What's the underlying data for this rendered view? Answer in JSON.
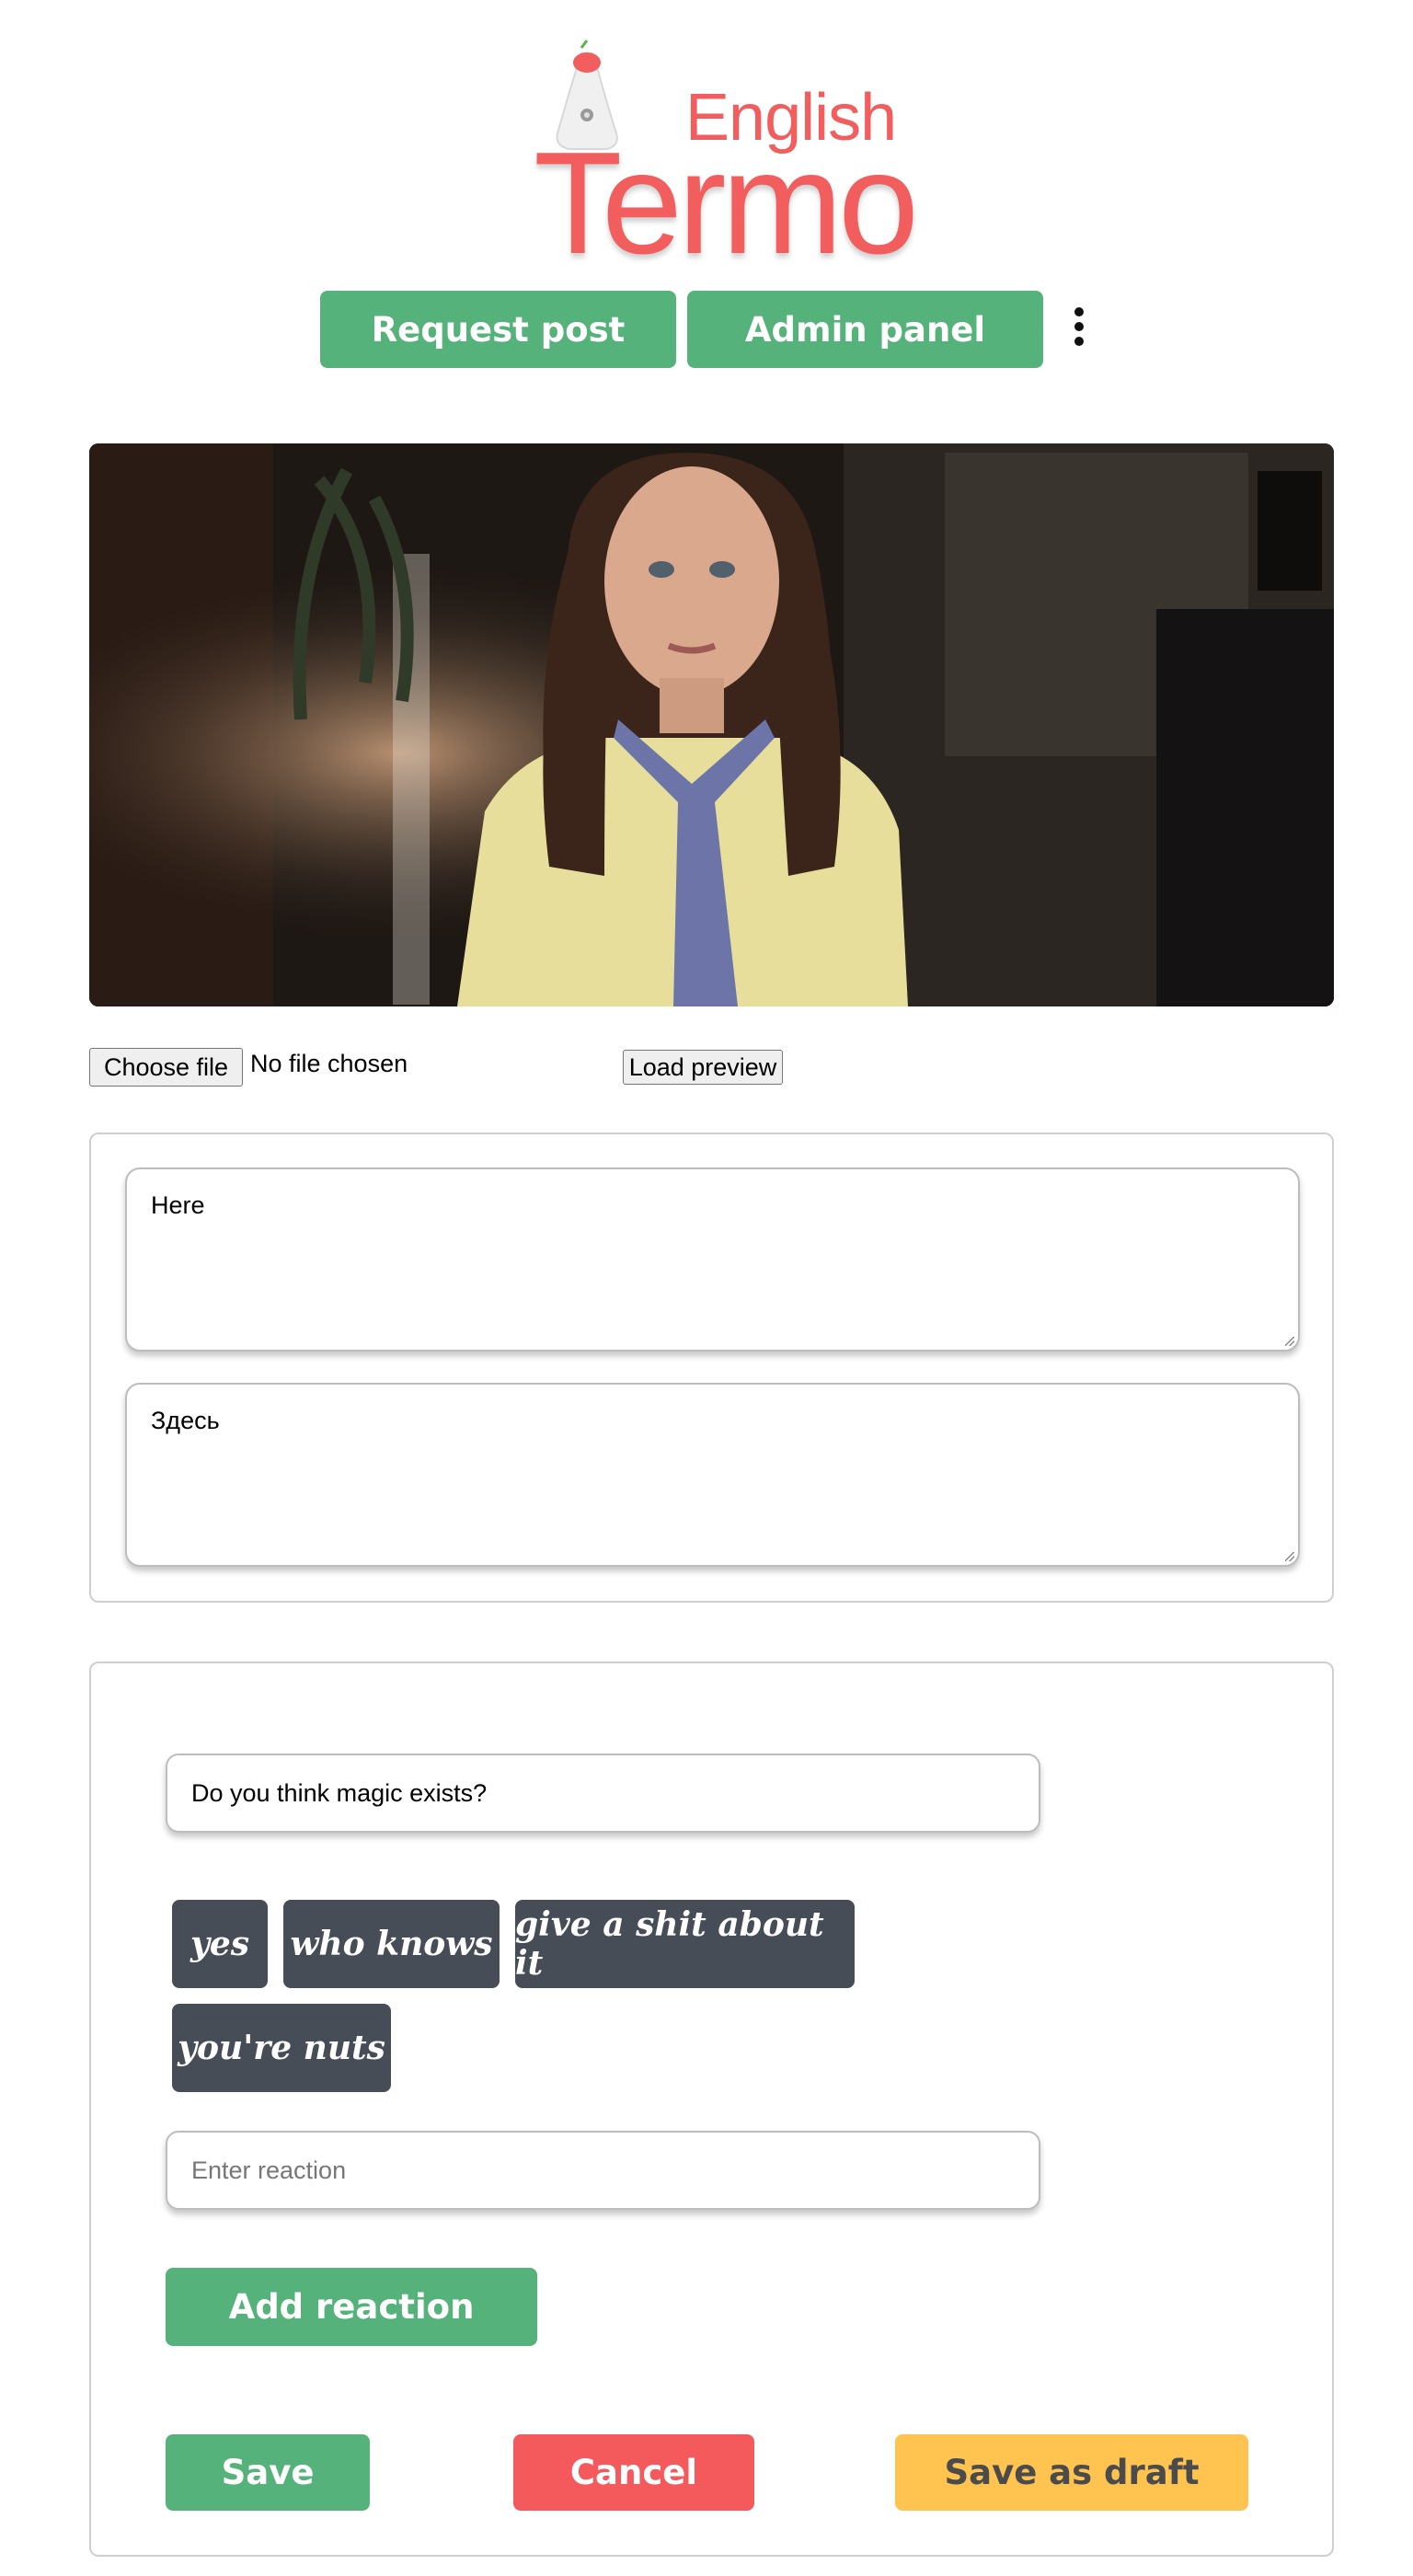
{
  "logo": {
    "word_small": "English",
    "word_large": "Termo",
    "color": "#f25d5d"
  },
  "nav": {
    "request_post_label": "Request post",
    "admin_panel_label": "Admin panel",
    "more_icon": "kebab-menu-icon"
  },
  "preview": {
    "image_desc": "movie-frame-photo"
  },
  "file": {
    "choose_label": "Choose file",
    "status": "No file chosen",
    "load_label": "Load preview"
  },
  "texts": {
    "english_value": "Here",
    "russian_value": "Здесь"
  },
  "quiz": {
    "question_value": "Do you think magic exists?",
    "reactions": [
      "yes",
      "who knows",
      "give a shit about it",
      "you're nuts"
    ],
    "reaction_placeholder": "Enter reaction",
    "add_reaction_label": "Add reaction"
  },
  "actions": {
    "save_label": "Save",
    "cancel_label": "Cancel",
    "draft_label": "Save as draft"
  },
  "colors": {
    "green": "#55b27a",
    "red": "#f45a5c",
    "yellow": "#ffc350",
    "chip": "#474d57"
  }
}
